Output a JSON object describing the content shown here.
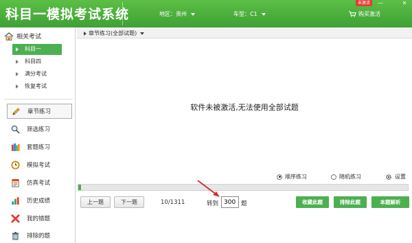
{
  "header": {
    "app_title": "科目一模拟考试系统",
    "region_label": "地区：贵州",
    "car_type_label": "车型：C1",
    "unactivated_badge": "未激活",
    "buy_label": "购买激活"
  },
  "sidebar": {
    "section_title": "相关考试",
    "tree_items": [
      {
        "label": "科目一",
        "selected": true
      },
      {
        "label": "科目四",
        "selected": false
      },
      {
        "label": "满分考试",
        "selected": false
      },
      {
        "label": "恢复考试",
        "selected": false
      }
    ],
    "menu_items": [
      {
        "label": "章节练习",
        "icon": "pencil-icon",
        "active": true
      },
      {
        "label": "筛选练习",
        "icon": "magnifier-icon",
        "active": false
      },
      {
        "label": "套题练习",
        "icon": "books-icon",
        "active": false
      },
      {
        "label": "模拟考试",
        "icon": "clock-icon",
        "active": false
      },
      {
        "label": "仿真考试",
        "icon": "notebook-icon",
        "active": false
      },
      {
        "label": "历史成绩",
        "icon": "bar-chart-icon",
        "active": false
      },
      {
        "label": "我的错题",
        "icon": "red-x-icon",
        "active": false
      },
      {
        "label": "排除的题",
        "icon": "trash-icon",
        "active": false
      }
    ]
  },
  "main": {
    "tab_label": "章节练习(全部试题)",
    "message": "软件未被激活,无法使用全部试题",
    "mode_sequential": "顺序练习",
    "mode_random": "随机练习",
    "selected_mode": "sequential",
    "settings_label": "设置",
    "progress_fraction": 0.008
  },
  "footer": {
    "prev_label": "上一题",
    "next_label": "下一题",
    "counter": "10/1311",
    "goto_label": "转到",
    "goto_value": "300",
    "goto_suffix": "题",
    "favorite_label": "收藏此题",
    "exclude_label": "排除此题",
    "explain_label": "本题解析"
  },
  "colors": {
    "accent": "#4caf50",
    "badge": "#e53935",
    "annotation_arrow": "#d32f2f"
  }
}
